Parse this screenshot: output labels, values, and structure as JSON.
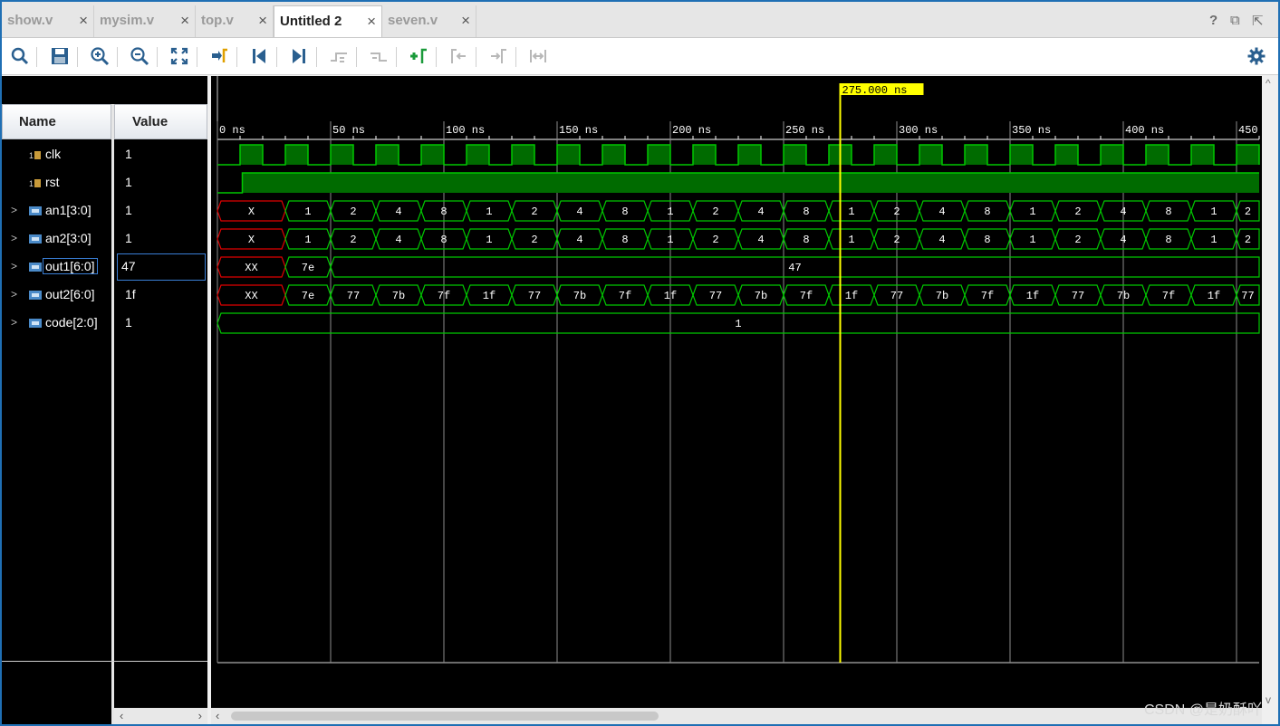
{
  "tabs": [
    {
      "label": "show.v",
      "active": false
    },
    {
      "label": "mysim.v",
      "active": false
    },
    {
      "label": "top.v",
      "active": false
    },
    {
      "label": "Untitled 2",
      "active": true
    },
    {
      "label": "seven.v",
      "active": false
    }
  ],
  "tab_close_glyph": "×",
  "window_controls": {
    "help": "?",
    "restore": "⧉",
    "popout": "⇱"
  },
  "toolbar_icons": [
    "search-icon",
    "save-icon",
    "zoom-in-icon",
    "zoom-out-icon",
    "zoom-fit-icon",
    "go-to-cursor-icon",
    "go-to-time-zero-icon",
    "go-to-last-time-icon",
    "previous-transition-icon",
    "next-transition-icon",
    "add-marker-icon",
    "previous-marker-icon",
    "next-marker-icon",
    "swap-cursors-icon"
  ],
  "settings_icon": "gear-icon",
  "columns": {
    "name": "Name",
    "value": "Value"
  },
  "signals": [
    {
      "name": "clk",
      "value": "1",
      "type": "bit",
      "expandable": false
    },
    {
      "name": "rst",
      "value": "1",
      "type": "bit",
      "expandable": false
    },
    {
      "name": "an1[3:0]",
      "value": "1",
      "type": "bus",
      "expandable": true
    },
    {
      "name": "an2[3:0]",
      "value": "1",
      "type": "bus",
      "expandable": true
    },
    {
      "name": "out1[6:0]",
      "value": "47",
      "type": "bus",
      "expandable": true,
      "selected": true
    },
    {
      "name": "out2[6:0]",
      "value": "1f",
      "type": "bus",
      "expandable": true
    },
    {
      "name": "code[2:0]",
      "value": "1",
      "type": "bus",
      "expandable": true
    }
  ],
  "expand_glyph": ">",
  "cursor": {
    "time_label": "275.000 ns",
    "time_ns": 275
  },
  "timescale": {
    "ticks": [
      "0 ns",
      "50 ns",
      "100 ns",
      "150 ns",
      "200 ns",
      "250 ns",
      "300 ns",
      "350 ns",
      "400 ns",
      "450"
    ],
    "tick_ns": [
      0,
      50,
      100,
      150,
      200,
      250,
      300,
      350,
      400,
      450
    ],
    "visible_range_ns": [
      0,
      462
    ]
  },
  "waves": {
    "clk": {
      "first_rise_ns": 10,
      "period_ns": 20,
      "high_ns": 10
    },
    "rst": {
      "rise_ns": 11
    },
    "an1": [
      {
        "t0": 0,
        "t1": 30,
        "v": "X",
        "x": true
      },
      {
        "t0": 30,
        "t1": 50,
        "v": "1"
      },
      {
        "t0": 50,
        "t1": 70,
        "v": "2"
      },
      {
        "t0": 70,
        "t1": 90,
        "v": "4"
      },
      {
        "t0": 90,
        "t1": 110,
        "v": "8"
      },
      {
        "t0": 110,
        "t1": 130,
        "v": "1"
      },
      {
        "t0": 130,
        "t1": 150,
        "v": "2"
      },
      {
        "t0": 150,
        "t1": 170,
        "v": "4"
      },
      {
        "t0": 170,
        "t1": 190,
        "v": "8"
      },
      {
        "t0": 190,
        "t1": 210,
        "v": "1"
      },
      {
        "t0": 210,
        "t1": 230,
        "v": "2"
      },
      {
        "t0": 230,
        "t1": 250,
        "v": "4"
      },
      {
        "t0": 250,
        "t1": 270,
        "v": "8"
      },
      {
        "t0": 270,
        "t1": 290,
        "v": "1"
      },
      {
        "t0": 290,
        "t1": 310,
        "v": "2"
      },
      {
        "t0": 310,
        "t1": 330,
        "v": "4"
      },
      {
        "t0": 330,
        "t1": 350,
        "v": "8"
      },
      {
        "t0": 350,
        "t1": 370,
        "v": "1"
      },
      {
        "t0": 370,
        "t1": 390,
        "v": "2"
      },
      {
        "t0": 390,
        "t1": 410,
        "v": "4"
      },
      {
        "t0": 410,
        "t1": 430,
        "v": "8"
      },
      {
        "t0": 430,
        "t1": 450,
        "v": "1"
      },
      {
        "t0": 450,
        "t1": 470,
        "v": "2"
      }
    ],
    "an2": [
      {
        "t0": 0,
        "t1": 30,
        "v": "X",
        "x": true
      },
      {
        "t0": 30,
        "t1": 50,
        "v": "1"
      },
      {
        "t0": 50,
        "t1": 70,
        "v": "2"
      },
      {
        "t0": 70,
        "t1": 90,
        "v": "4"
      },
      {
        "t0": 90,
        "t1": 110,
        "v": "8"
      },
      {
        "t0": 110,
        "t1": 130,
        "v": "1"
      },
      {
        "t0": 130,
        "t1": 150,
        "v": "2"
      },
      {
        "t0": 150,
        "t1": 170,
        "v": "4"
      },
      {
        "t0": 170,
        "t1": 190,
        "v": "8"
      },
      {
        "t0": 190,
        "t1": 210,
        "v": "1"
      },
      {
        "t0": 210,
        "t1": 230,
        "v": "2"
      },
      {
        "t0": 230,
        "t1": 250,
        "v": "4"
      },
      {
        "t0": 250,
        "t1": 270,
        "v": "8"
      },
      {
        "t0": 270,
        "t1": 290,
        "v": "1"
      },
      {
        "t0": 290,
        "t1": 310,
        "v": "2"
      },
      {
        "t0": 310,
        "t1": 330,
        "v": "4"
      },
      {
        "t0": 330,
        "t1": 350,
        "v": "8"
      },
      {
        "t0": 350,
        "t1": 370,
        "v": "1"
      },
      {
        "t0": 370,
        "t1": 390,
        "v": "2"
      },
      {
        "t0": 390,
        "t1": 410,
        "v": "4"
      },
      {
        "t0": 410,
        "t1": 430,
        "v": "8"
      },
      {
        "t0": 430,
        "t1": 450,
        "v": "1"
      },
      {
        "t0": 450,
        "t1": 470,
        "v": "2"
      }
    ],
    "out1": [
      {
        "t0": 0,
        "t1": 30,
        "v": "XX",
        "x": true
      },
      {
        "t0": 30,
        "t1": 50,
        "v": "7e"
      },
      {
        "t0": 50,
        "t1": 470,
        "v": "47"
      }
    ],
    "out2": [
      {
        "t0": 0,
        "t1": 30,
        "v": "XX",
        "x": true
      },
      {
        "t0": 30,
        "t1": 50,
        "v": "7e"
      },
      {
        "t0": 50,
        "t1": 70,
        "v": "77"
      },
      {
        "t0": 70,
        "t1": 90,
        "v": "7b"
      },
      {
        "t0": 90,
        "t1": 110,
        "v": "7f"
      },
      {
        "t0": 110,
        "t1": 130,
        "v": "1f"
      },
      {
        "t0": 130,
        "t1": 150,
        "v": "77"
      },
      {
        "t0": 150,
        "t1": 170,
        "v": "7b"
      },
      {
        "t0": 170,
        "t1": 190,
        "v": "7f"
      },
      {
        "t0": 190,
        "t1": 210,
        "v": "1f"
      },
      {
        "t0": 210,
        "t1": 230,
        "v": "77"
      },
      {
        "t0": 230,
        "t1": 250,
        "v": "7b"
      },
      {
        "t0": 250,
        "t1": 270,
        "v": "7f"
      },
      {
        "t0": 270,
        "t1": 290,
        "v": "1f"
      },
      {
        "t0": 290,
        "t1": 310,
        "v": "77"
      },
      {
        "t0": 310,
        "t1": 330,
        "v": "7b"
      },
      {
        "t0": 330,
        "t1": 350,
        "v": "7f"
      },
      {
        "t0": 350,
        "t1": 370,
        "v": "1f"
      },
      {
        "t0": 370,
        "t1": 390,
        "v": "77"
      },
      {
        "t0": 390,
        "t1": 410,
        "v": "7b"
      },
      {
        "t0": 410,
        "t1": 430,
        "v": "7f"
      },
      {
        "t0": 430,
        "t1": 450,
        "v": "1f"
      },
      {
        "t0": 450,
        "t1": 470,
        "v": "77"
      }
    ],
    "code": [
      {
        "t0": 0,
        "t1": 470,
        "v": "1"
      }
    ]
  },
  "colors": {
    "wave_green": "#00c800",
    "bit_fill": "#006b00",
    "x_red": "#e00000",
    "cursor_yellow": "#ffff00",
    "grid": "#8c8c8c"
  },
  "watermark": "CSDN @是奶酥吖"
}
